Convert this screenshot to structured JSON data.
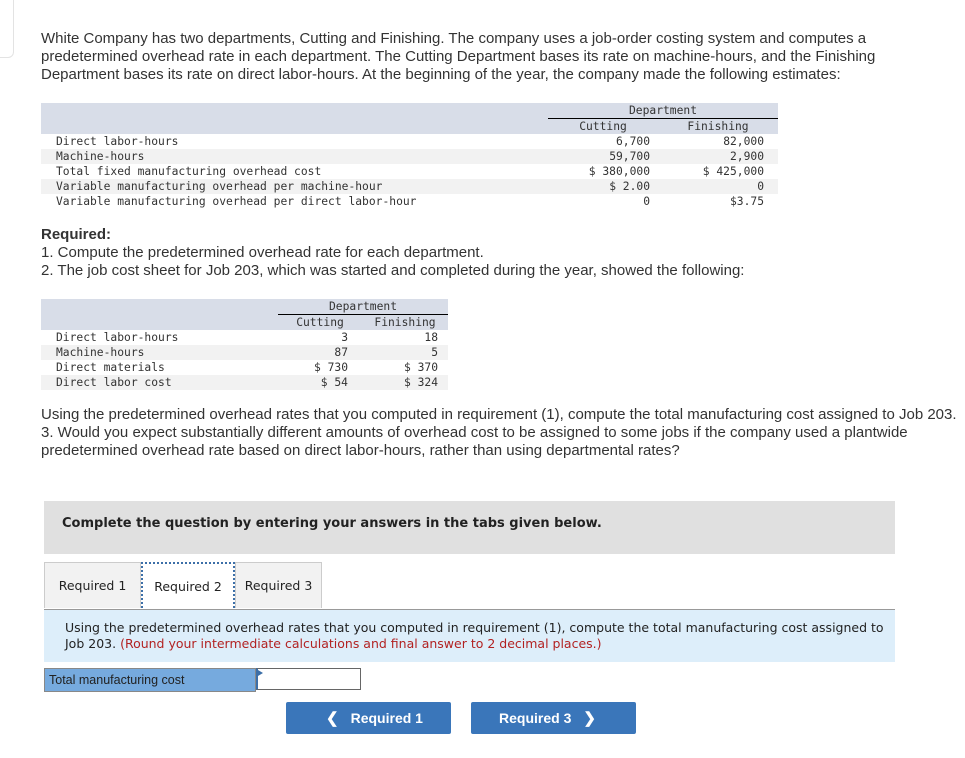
{
  "intro": "White Company has two departments, Cutting and Finishing. The company uses a job-order costing system and computes a predetermined overhead rate in each department. The Cutting Department bases its rate on machine-hours, and the Finishing Department bases its rate on direct labor-hours. At the beginning of the year, the company made the following estimates:",
  "estimates": {
    "group_header": "Department",
    "columns": [
      "Cutting",
      "Finishing"
    ],
    "rows": [
      {
        "label": "Direct labor-hours",
        "cutting": "6,700",
        "finishing": "82,000"
      },
      {
        "label": "Machine-hours",
        "cutting": "59,700",
        "finishing": "2,900"
      },
      {
        "label": "Total fixed manufacturing overhead cost",
        "cutting": "$ 380,000",
        "finishing": "$ 425,000"
      },
      {
        "label": "Variable manufacturing overhead per machine-hour",
        "cutting": "$ 2.00",
        "finishing": "0"
      },
      {
        "label": "Variable manufacturing overhead per direct labor-hour",
        "cutting": "0",
        "finishing": "$3.75"
      }
    ]
  },
  "required": {
    "heading": "Required:",
    "item1": "1. Compute the predetermined overhead rate for each department.",
    "item2": "2. The job cost sheet for Job 203, which was started and completed during the year, showed the following:"
  },
  "job": {
    "group_header": "Department",
    "columns": [
      "Cutting",
      "Finishing"
    ],
    "rows": [
      {
        "label": "Direct labor-hours",
        "cutting": "3",
        "finishing": "18"
      },
      {
        "label": "Machine-hours",
        "cutting": "87",
        "finishing": "5"
      },
      {
        "label": "Direct materials",
        "cutting": "$ 730",
        "finishing": "$ 370"
      },
      {
        "label": "Direct labor cost",
        "cutting": "$ 54",
        "finishing": "$ 324"
      }
    ]
  },
  "para2": {
    "line1": "Using the predetermined overhead rates that you computed in requirement (1), compute the total manufacturing cost assigned to Job 203.",
    "item3": "3. Would you expect substantially different amounts of overhead cost to be assigned to some jobs if the company used a plantwide predetermined overhead rate based on direct labor-hours, rather than using departmental rates?"
  },
  "instruction": "Complete the question by entering your answers in the tabs given below.",
  "tabs": [
    {
      "label": "Required 1",
      "active": false
    },
    {
      "label": "Required 2",
      "active": true
    },
    {
      "label": "Required 3",
      "active": false
    }
  ],
  "tab_content": {
    "text": "Using the predetermined overhead rates that you computed in requirement (1), compute the total manufacturing cost assigned to Job 203.",
    "note": "(Round your intermediate calculations and final answer to 2 decimal places.)"
  },
  "answer": {
    "label": "Total manufacturing cost",
    "value": ""
  },
  "nav": {
    "prev_label": "Required 1",
    "next_label": "Required 3",
    "prev_icon": "chevron-left-icon",
    "next_icon": "chevron-right-icon"
  }
}
